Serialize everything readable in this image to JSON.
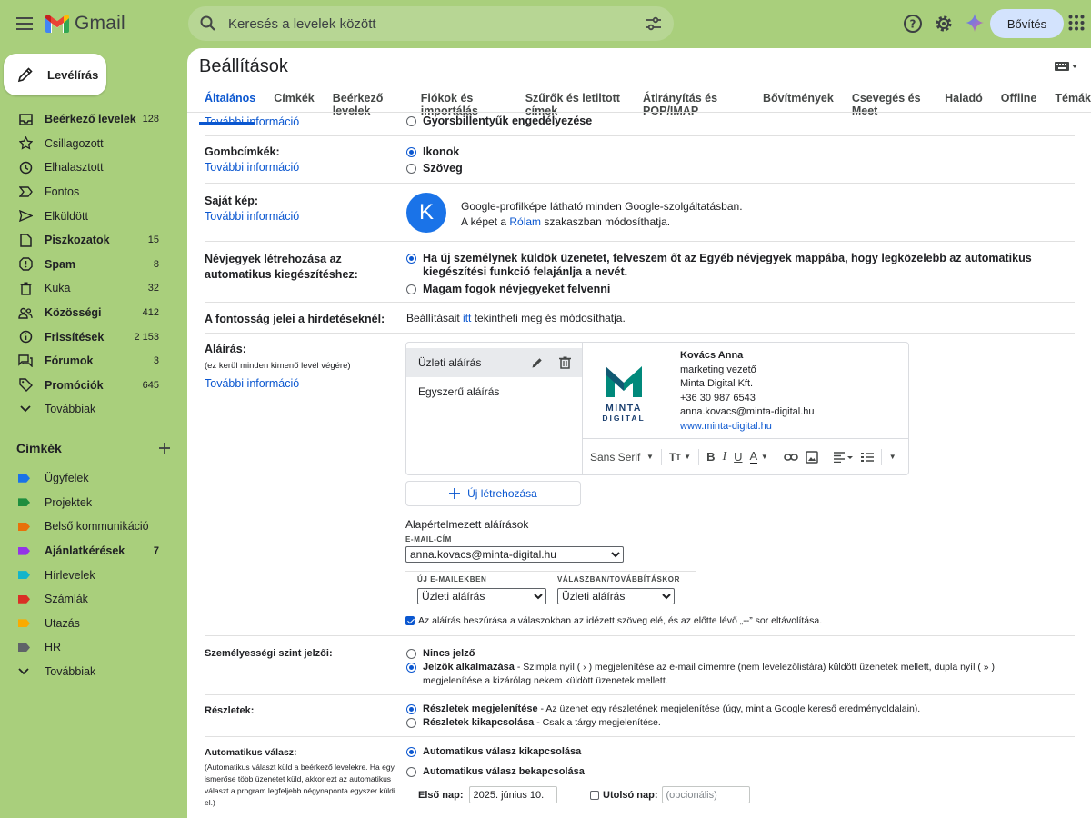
{
  "app": {
    "name": "Gmail"
  },
  "search": {
    "placeholder": "Keresés a levelek között"
  },
  "header": {
    "upgrade_label": "Bővítés"
  },
  "compose": {
    "label": "Levélírás"
  },
  "nav": [
    {
      "label": "Beérkező levelek",
      "count": "128",
      "bold": true,
      "icon": "inbox-icon"
    },
    {
      "label": "Csillagozott",
      "count": "",
      "bold": false,
      "icon": "star-icon"
    },
    {
      "label": "Elhalasztott",
      "count": "",
      "bold": false,
      "icon": "clock-icon"
    },
    {
      "label": "Fontos",
      "count": "",
      "bold": false,
      "icon": "important-icon"
    },
    {
      "label": "Elküldött",
      "count": "",
      "bold": false,
      "icon": "send-icon"
    },
    {
      "label": "Piszkozatok",
      "count": "15",
      "bold": true,
      "icon": "draft-icon"
    },
    {
      "label": "Spam",
      "count": "8",
      "bold": true,
      "icon": "spam-icon"
    },
    {
      "label": "Kuka",
      "count": "32",
      "bold": false,
      "icon": "trash-icon"
    },
    {
      "label": "Közösségi",
      "count": "412",
      "bold": true,
      "icon": "people-icon"
    },
    {
      "label": "Frissítések",
      "count": "2 153",
      "bold": true,
      "icon": "info-icon"
    },
    {
      "label": "Fórumok",
      "count": "3",
      "bold": true,
      "icon": "forum-icon"
    },
    {
      "label": "Promóciók",
      "count": "645",
      "bold": true,
      "icon": "tag-icon"
    },
    {
      "label": "Továbbiak",
      "count": "",
      "bold": false,
      "icon": "chevron-down-icon"
    }
  ],
  "labels_section": {
    "title": "Címkék",
    "items": [
      {
        "label": "Ügyfelek",
        "count": "",
        "bold": false,
        "color": "#1a73e8"
      },
      {
        "label": "Projektek",
        "count": "",
        "bold": false,
        "color": "#1e8e3e"
      },
      {
        "label": "Belső kommunikáció",
        "count": "",
        "bold": false,
        "color": "#e8710a"
      },
      {
        "label": "Ajánlatkérések",
        "count": "7",
        "bold": true,
        "color": "#9334e6"
      },
      {
        "label": "Hírlevelek",
        "count": "",
        "bold": false,
        "color": "#12b5cb"
      },
      {
        "label": "Számlák",
        "count": "",
        "bold": false,
        "color": "#d93025"
      },
      {
        "label": "Utazás",
        "count": "",
        "bold": false,
        "color": "#f9ab00"
      },
      {
        "label": "HR",
        "count": "",
        "bold": false,
        "color": "#5f6368"
      }
    ],
    "more_label": "Továbbiak"
  },
  "settings": {
    "title": "Beállítások",
    "tabs": [
      "Általános",
      "Címkék",
      "Beérkező levelek",
      "Fiókok és importálás",
      "Szűrők és letiltott címek",
      "Átirányítás és POP/IMAP",
      "Bővítmények",
      "Csevegés és Meet",
      "Haladó",
      "Offline",
      "Témák"
    ],
    "active_tab": "Általános",
    "more_info": "További információ",
    "shortcuts": {
      "option": "Gyorsbillentyűk engedélyezése"
    },
    "button_labels": {
      "label": "Gombcímkék:",
      "options": [
        "Ikonok",
        "Szöveg"
      ]
    },
    "picture": {
      "label": "Saját kép:",
      "avatar_letter": "K",
      "avatar_color": "#1a73e8",
      "line1": "Google-profilképe látható minden Google-szolgáltatásban.",
      "line2_pre": "A képet a ",
      "line2_link": "Rólam",
      "line2_post": " szakaszban módosíthatja."
    },
    "contacts": {
      "label": "Névjegyek létrehozása az automatikus kiegészítéshez:",
      "option1": "Ha új személynek küldök üzenetet, felveszem őt az Egyéb névjegyek mappába, hogy legközelebb az automatikus kiegészítési funkció felajánlja a nevét.",
      "option2": "Magam fogok névjegyeket felvenni"
    },
    "importance": {
      "label": "A fontosság jelei a hirdetéseknél:",
      "text_pre": "Beállításait ",
      "link": "itt",
      "text_post": " tekintheti meg és módosíthatja."
    },
    "signature": {
      "label": "Aláírás:",
      "sub": "(ez kerül minden kimenő levél végére)",
      "list": [
        "Üzleti aláírás",
        "Egyszerű aláírás"
      ],
      "content": {
        "name": "Kovács Anna",
        "title": "marketing vezető",
        "company": "Minta Digital Kft.",
        "phone": "+36 30 987 6543",
        "email": "anna.kovacs@minta-digital.hu",
        "web": "www.minta-digital.hu",
        "logo_line1": "MINTA",
        "logo_line2": "DIGITAL",
        "logo_color": "#00897b"
      },
      "toolbar_font": "Sans Serif",
      "new_label": "Új létrehozása",
      "defaults_title": "Alapértelmezett aláírások",
      "email_caption": "E-MAIL-CÍM",
      "email_value": "anna.kovacs@minta-digital.hu",
      "new_caption": "ÚJ E-MAILEKBEN",
      "new_value": "Üzleti aláírás",
      "reply_caption": "VÁLASZBAN/TOVÁBBÍTÁSKOR",
      "reply_value": "Üzleti aláírás",
      "insert_text": "Az aláírás beszúrása a válaszokban az idézett szöveg elé, és az előtte lévő „--” sor eltávolítása."
    },
    "personal": {
      "label": "Személyességi szint jelzői:",
      "opt1": "Nincs jelző",
      "opt2_bold": "Jelzők alkalmazása",
      "opt2_text": " - Szimpla nyíl ( › ) megjelenítése az e-mail címemre (nem levelezőlistára) küldött üzenetek mellett, dupla nyíl ( » ) megjelenítése a kizárólag nekem küldött üzenetek mellett."
    },
    "snippets": {
      "label": "Részletek:",
      "opt1_bold": "Részletek megjelenítése",
      "opt1_text": " - Az üzenet egy részletének megjelenítése (úgy, mint a Google kereső eredményoldalain).",
      "opt2_bold": "Részletek kikapcsolása",
      "opt2_text": " - Csak a tárgy megjelenítése."
    },
    "vacation": {
      "label": "Automatikus válasz:",
      "sub": "(Automatikus választ küld a beérkező levelekre. Ha egy ismerőse több üzenetet küld, akkor ezt az automatikus választ a program legfeljebb négynaponta egyszer küldi el.)",
      "opt1": "Automatikus válasz kikapcsolása",
      "opt2": "Automatikus válasz bekapcsolása",
      "first_day_label": "Első nap:",
      "first_day_value": "2025. június 10.",
      "last_day_label": "Utolsó nap:",
      "last_day_placeholder": "(opcionális)"
    }
  }
}
